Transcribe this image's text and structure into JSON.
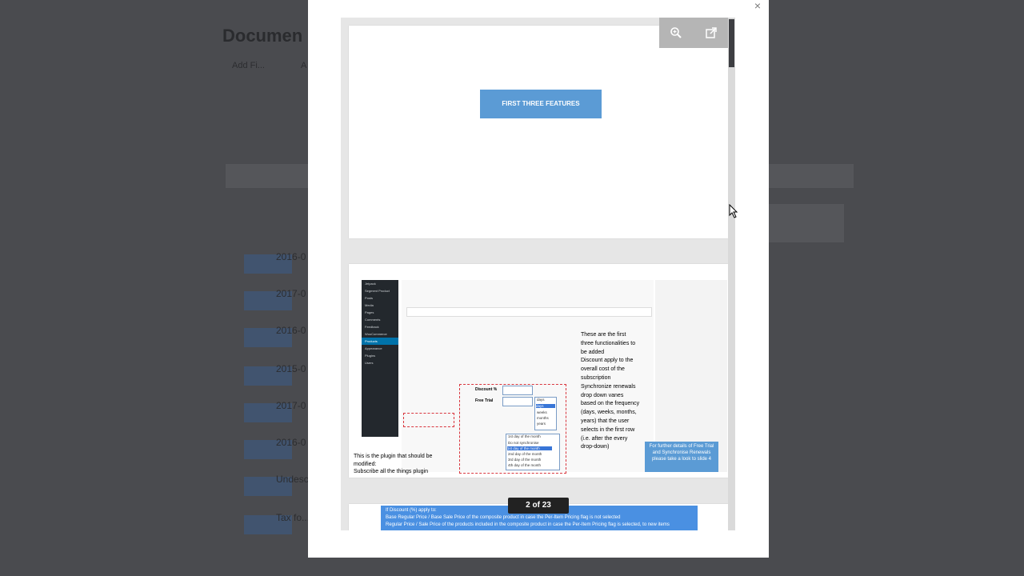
{
  "background": {
    "title": "Documen",
    "link1": "Add Fi...",
    "link2": "A",
    "rows": [
      "2016-0",
      "2017-0",
      "2016-0",
      "2015-0",
      "2017-0",
      "2016-0",
      "Undesc...",
      "Tax fo..."
    ]
  },
  "viewer": {
    "close_label": "×",
    "counter": "2 of 23",
    "toolbar": {
      "zoom_icon": "zoom-in-icon",
      "open_icon": "external-link-icon"
    }
  },
  "slide1": {
    "button": "FIRST THREE FEATURES"
  },
  "slide2": {
    "annotation_main": [
      "These are the first",
      "three functionalities to",
      "be added",
      "Discount apply to the",
      "overall cost of the",
      "subscription",
      "Synchronize renewals",
      "drop down vanes",
      "based on the frequency",
      "(days, weeks, months,",
      "years) that the user",
      "selects in the first row",
      "(i.e. after the every",
      "drop-down)"
    ],
    "annotation_plugin": [
      "This is the plugin that should be",
      "modified:",
      "Subscribe all the things plugin"
    ],
    "note": "For further details of Free Trial and Synchronise Renewals please take a look to slide 4",
    "discount_label": "Discount %",
    "free_trial_label": "Free Trial",
    "period_options": [
      "days",
      "days",
      "weeks",
      "months",
      "years"
    ],
    "sync_options": [
      "1st day of the month",
      "Do not synchronise",
      "1st day of the month",
      "2nd day of the month",
      "3rd day of the month",
      "4th day of the month"
    ],
    "sidebar_items": [
      "Jetpack",
      "Segment Product",
      "Posts",
      "Media",
      "Pages",
      "Comments",
      "Feedback",
      "WooCommerce",
      "Products",
      "Appearance",
      "Plugins",
      "Users"
    ]
  },
  "slide3": {
    "lines": [
      "If Discount (%) apply to:",
      "Base Regular Price / Base Sale Price of the composite product in case the Per-Item Pricing flag is not selected",
      "Regular Price / Sale Price of the products included in the composite product in case the Per-Item Pricing flag is selected, to new items"
    ]
  }
}
